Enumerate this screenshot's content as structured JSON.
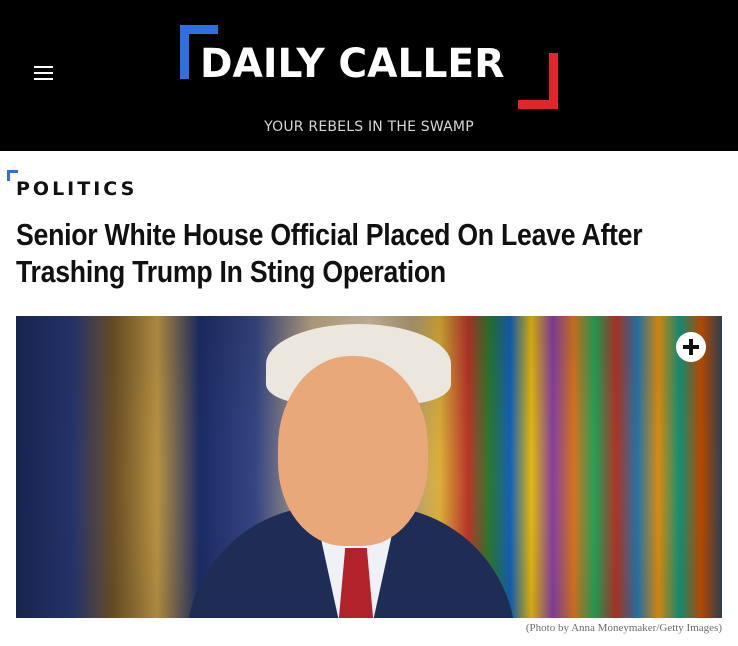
{
  "header": {
    "logo_text": "DAILY CALLER",
    "tagline": "YOUR REBELS IN THE SWAMP",
    "brand_colors": {
      "blue": "#2f6fe0",
      "red": "#e0262a",
      "background": "#000000"
    },
    "menu_icon": "hamburger-menu-icon"
  },
  "article": {
    "category": "POLITICS",
    "headline": "Senior White House Official Placed On Leave After Trashing Trump In Sting Operation",
    "photo_caption": "(Photo by Anna Moneymaker/Getty Images)",
    "expand_icon": "plus-circle-icon"
  }
}
